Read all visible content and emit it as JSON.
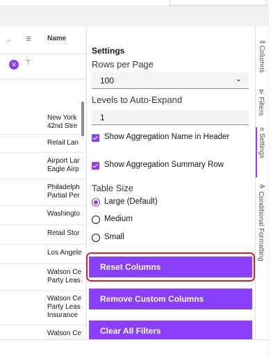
{
  "grid": {
    "header": {
      "overflow_label": "..",
      "name_label": "Name"
    },
    "filter_row": {
      "clear_icon_glyph": "✕",
      "filter_icon_glyph": "⊤"
    },
    "rows": [
      {
        "text": "New York\n42nd Stre"
      },
      {
        "text": "Retail Lan"
      },
      {
        "text": "Airport Lar\nEagle Airp"
      },
      {
        "text": "Philadelph\nPartial Per"
      },
      {
        "text": "Washingto"
      },
      {
        "text": "Retail Stor"
      },
      {
        "text": "Los Angele"
      },
      {
        "text": "Watson Ce\nParty Leas"
      },
      {
        "text": "Watson Ce\nParty Leas\nInsurance"
      },
      {
        "text": "Watson Ce"
      }
    ]
  },
  "settings": {
    "title": "Settings",
    "rows_per_page": {
      "label": "Rows per Page",
      "value": "100"
    },
    "levels_auto_expand": {
      "label": "Levels to Auto-Expand",
      "value": "1"
    },
    "checkboxes": [
      {
        "label": "Show Aggregation Name in Header",
        "checked": true
      },
      {
        "label": "Show Aggregation Summary Row",
        "checked": true
      }
    ],
    "table_size": {
      "label": "Table Size",
      "options": [
        {
          "label": "Large (Default)",
          "selected": true
        },
        {
          "label": "Medium",
          "selected": false
        },
        {
          "label": "Small",
          "selected": false
        }
      ]
    },
    "buttons": {
      "reset_columns": "Reset Columns",
      "remove_custom_columns": "Remove Custom Columns",
      "clear_all_filters": "Clear All Filters"
    }
  },
  "rail": {
    "tabs": [
      {
        "label": "Columns",
        "icon": "columns-icon",
        "glyph": "⦀"
      },
      {
        "label": "Filters",
        "icon": "filter-icon",
        "glyph": "⊳"
      },
      {
        "label": "Settings",
        "icon": "settings-icon",
        "glyph": "≡",
        "active": true
      },
      {
        "label": "Conditional Formatting",
        "icon": "conditional-formatting-icon",
        "glyph": "≜"
      }
    ]
  },
  "colors": {
    "accent": "#8a3ffc",
    "highlight_outline": "#da1e28"
  }
}
